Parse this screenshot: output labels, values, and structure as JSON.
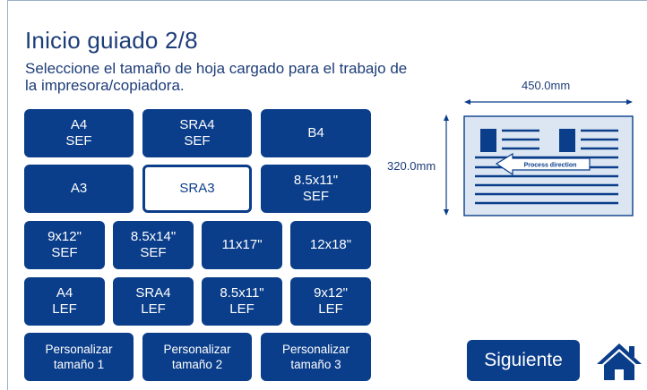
{
  "header": {
    "title": "Inicio guiado 2/8",
    "subtitle": "Seleccione el tamaño de hoja cargado para el trabajo de la impresora/copiadora."
  },
  "sizes": [
    {
      "label": "A4\nSEF",
      "selected": false
    },
    {
      "label": "SRA4\nSEF",
      "selected": false
    },
    {
      "label": "B4",
      "selected": false
    },
    {
      "label": "A3",
      "selected": false
    },
    {
      "label": "SRA3",
      "selected": true
    },
    {
      "label": "8.5x11\"\nSEF",
      "selected": false
    },
    {
      "label": "9x12\"\nSEF",
      "selected": false
    },
    {
      "label": "8.5x14\"\nSEF",
      "selected": false
    },
    {
      "label": "11x17\"",
      "selected": false
    },
    {
      "label": "12x18\"",
      "selected": false
    },
    {
      "label": "A4\nLEF",
      "selected": false
    },
    {
      "label": "SRA4\nLEF",
      "selected": false
    },
    {
      "label": "8.5x11\"\nLEF",
      "selected": false
    },
    {
      "label": "9x12\"\nLEF",
      "selected": false
    },
    {
      "label": "Personalizar\ntamaño 1",
      "selected": false
    },
    {
      "label": "Personalizar\ntamaño 2",
      "selected": false
    },
    {
      "label": "Personalizar\ntamaño 3",
      "selected": false
    }
  ],
  "preview": {
    "width_label": "450.0mm",
    "height_label": "320.0mm",
    "direction_label": "Process direction"
  },
  "footer": {
    "next_label": "Siguiente",
    "home_icon": "home-icon"
  },
  "colors": {
    "primary": "#0a3d8a",
    "text": "#1d3d78",
    "paper": "#dce6f2"
  }
}
